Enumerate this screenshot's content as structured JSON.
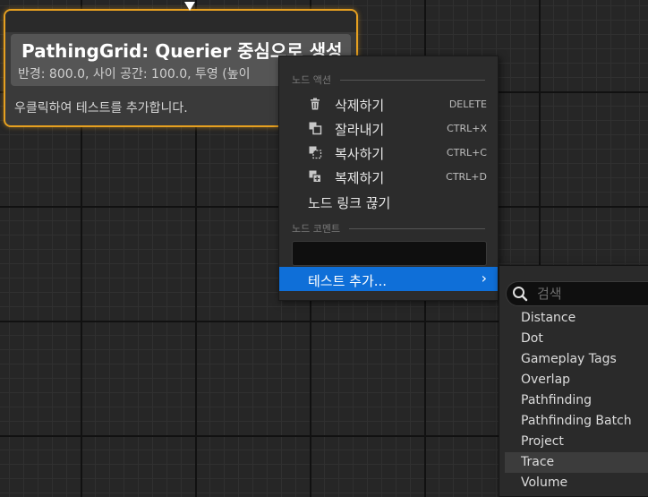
{
  "node": {
    "title": "PathingGrid: Querier 중심으로 생성",
    "subtitle": "반경: 800.0, 사이 공간: 100.0, 투영 (높이",
    "hint": "우클릭하여 테스트를 추가합니다.",
    "border_color": "#e6a020"
  },
  "context_menu": {
    "node_actions_header": "노드 액션",
    "items": [
      {
        "label": "삭제하기",
        "shortcut": "DELETE",
        "icon": "trash-icon"
      },
      {
        "label": "잘라내기",
        "shortcut": "CTRL+X",
        "icon": "cut-icon"
      },
      {
        "label": "복사하기",
        "shortcut": "CTRL+C",
        "icon": "copy-icon"
      },
      {
        "label": "복제하기",
        "shortcut": "CTRL+D",
        "icon": "duplicate-icon"
      },
      {
        "label": "노드 링크 끊기",
        "shortcut": "",
        "icon": ""
      }
    ],
    "node_comment_header": "노드 코멘트",
    "comment_value": "",
    "add_test_label": "테스트 추가...",
    "highlight_color": "#0f6fd8"
  },
  "submenu": {
    "search_placeholder": "검색",
    "options": [
      "Distance",
      "Dot",
      "Gameplay Tags",
      "Overlap",
      "Pathfinding",
      "Pathfinding Batch",
      "Project",
      "Trace",
      "Volume"
    ],
    "highlighted": "Trace"
  }
}
